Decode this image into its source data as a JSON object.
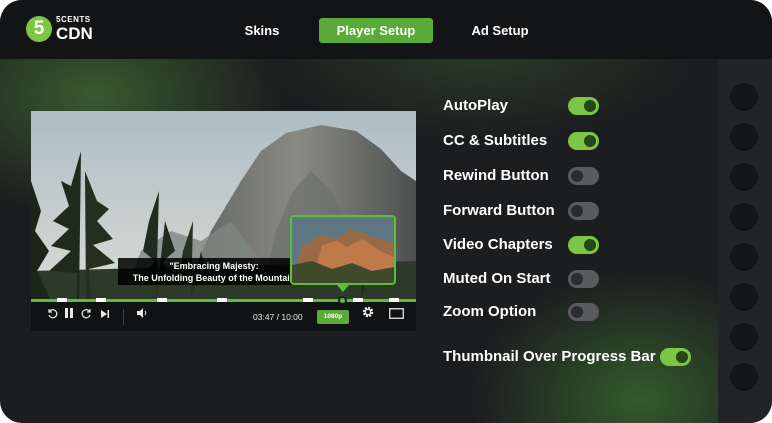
{
  "logo": {
    "badge": "5",
    "top": "5CENTS",
    "bottom": "CDN"
  },
  "tabs": [
    {
      "label": "Skins",
      "active": false
    },
    {
      "label": "Player Setup",
      "active": true
    },
    {
      "label": "Ad Setup",
      "active": false
    }
  ],
  "player": {
    "caption_line1": "\"Embracing Majesty:",
    "caption_line2": "The Unfolding Beauty of the Mountain",
    "time": "03:47 / 10:00",
    "quality": "1080p",
    "progress": 0.8
  },
  "settings": [
    {
      "label": "AutoPlay",
      "on": true
    },
    {
      "label": "CC & Subtitles",
      "on": true
    },
    {
      "label": "Rewind Button",
      "on": false
    },
    {
      "label": "Forward Button",
      "on": false
    },
    {
      "label": "Video Chapters",
      "on": true
    },
    {
      "label": "Muted On Start",
      "on": false
    },
    {
      "label": "Zoom Option",
      "on": false
    },
    {
      "label": "Thumbnail Over Progress Bar",
      "on": true
    }
  ],
  "colors": {
    "accent": "#7cc545",
    "tab_active": "#5aaa3a",
    "background": "#1c1d1f"
  }
}
